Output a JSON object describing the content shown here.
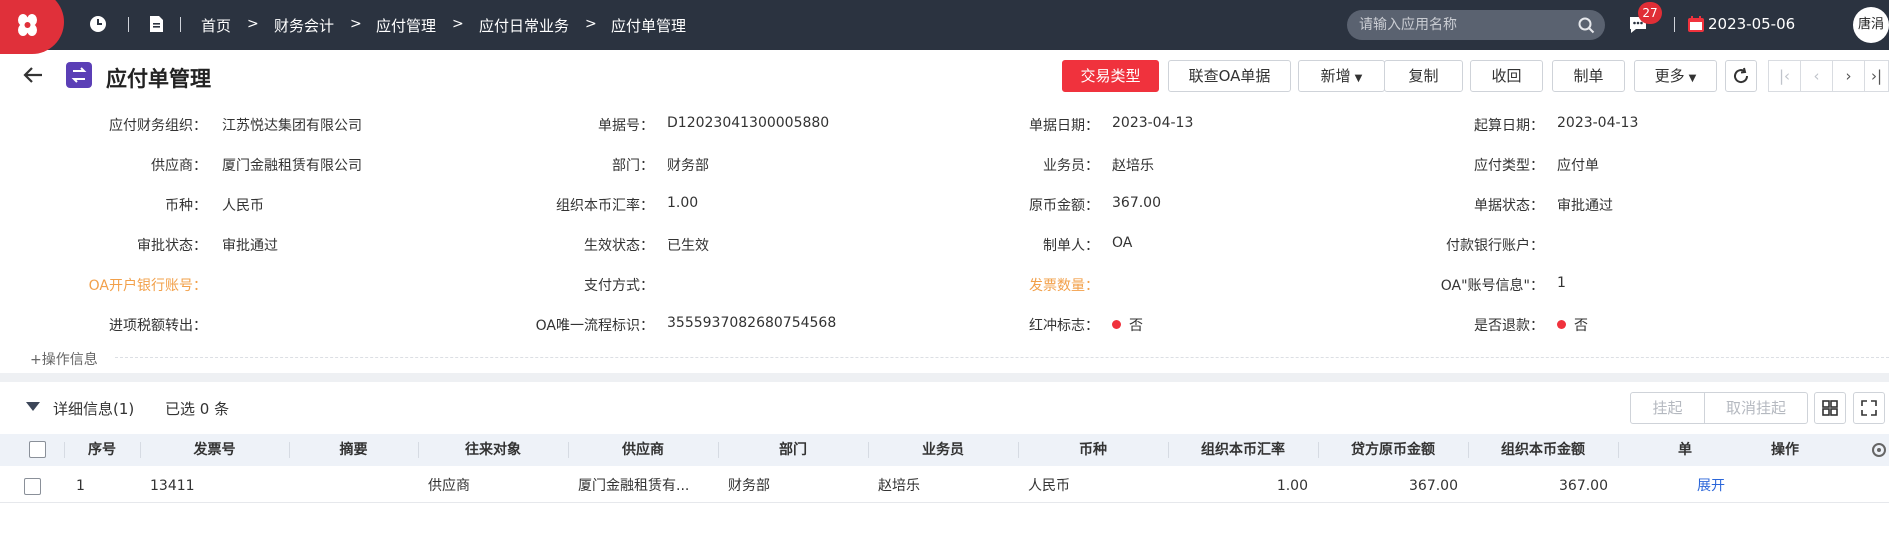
{
  "topbar": {
    "breadcrumbs": [
      "首页",
      "财务会计",
      "应付管理",
      "应付日常业务",
      "应付单管理"
    ],
    "search_placeholder": "请输入应用名称",
    "notification_count": "27",
    "date": "2023-05-06",
    "user": "唐涓"
  },
  "header": {
    "title": "应付单管理",
    "buttons": {
      "trade_type": "交易类型",
      "oa_link": "联查OA单据",
      "add": "新增",
      "copy": "复制",
      "recall": "收回",
      "make": "制单",
      "more": "更多"
    },
    "nav": {
      "first": "|‹",
      "prev": "‹",
      "next": "›",
      "last": "›|"
    }
  },
  "form": {
    "org_label": "应付财务组织：",
    "org_value": "江苏悦达集团有限公司",
    "billno_label": "单据号：",
    "billno_value": "D12023041300005880",
    "billdate_label": "单据日期：",
    "billdate_value": "2023-04-13",
    "startdate_label": "起算日期：",
    "startdate_value": "2023-04-13",
    "supplier_label": "供应商：",
    "supplier_value": "厦门金融租赁有限公司",
    "dept_label": "部门：",
    "dept_value": "财务部",
    "salesman_label": "业务员：",
    "salesman_value": "赵培乐",
    "paytype_label": "应付类型：",
    "paytype_value": "应付单",
    "currency_label": "币种：",
    "currency_value": "人民币",
    "rate_label": "组织本币汇率：",
    "rate_value": "1.00",
    "amount_label": "原币金额：",
    "amount_value": "367.00",
    "billstatus_label": "单据状态：",
    "billstatus_value": "审批通过",
    "approval_label": "审批状态：",
    "approval_value": "审批通过",
    "effect_label": "生效状态：",
    "effect_value": "已生效",
    "maker_label": "制单人：",
    "maker_value": "OA",
    "bankacct_label": "付款银行账户：",
    "bankacct_value": "",
    "oabank_label": "OA开户银行账号：",
    "oabank_value": "",
    "paymethod_label": "支付方式：",
    "paymethod_value": "",
    "invoicecount_label": "发票数量：",
    "invoicecount_value": "",
    "oaacct_label": "OA\"账号信息\"：",
    "oaacct_value": "1",
    "taxout_label": "进项税额转出：",
    "taxout_value": "",
    "oaflow_label": "OA唯一流程标识：",
    "oaflow_value": "3555937082680754568",
    "redflag_label": "红冲标志：",
    "redflag_value": "否",
    "refund_label": "是否退款：",
    "refund_value": "否",
    "ops_info": "+操作信息"
  },
  "details": {
    "title": "详细信息(1)",
    "selected": "已选 0 条",
    "hang": "挂起",
    "unhang": "取消挂起",
    "columns": [
      "序号",
      "发票号",
      "摘要",
      "往来对象",
      "供应商",
      "部门",
      "业务员",
      "币种",
      "组织本币汇率",
      "贷方原币金额",
      "组织本币金额",
      "单",
      "操作"
    ],
    "rows": [
      {
        "no": "1",
        "invoice": "13411",
        "summary": "",
        "party": "供应商",
        "supplier": "厦门金融租赁有...",
        "dept": "财务部",
        "salesman": "赵培乐",
        "currency": "人民币",
        "rate": "1.00",
        "credit": "367.00",
        "local": "367.00",
        "action": "展开"
      }
    ]
  },
  "colors": {
    "accent_red": "#f0323d",
    "topbar": "#2b3340",
    "link": "#2b66d9",
    "orange_label": "#f2a04a"
  }
}
